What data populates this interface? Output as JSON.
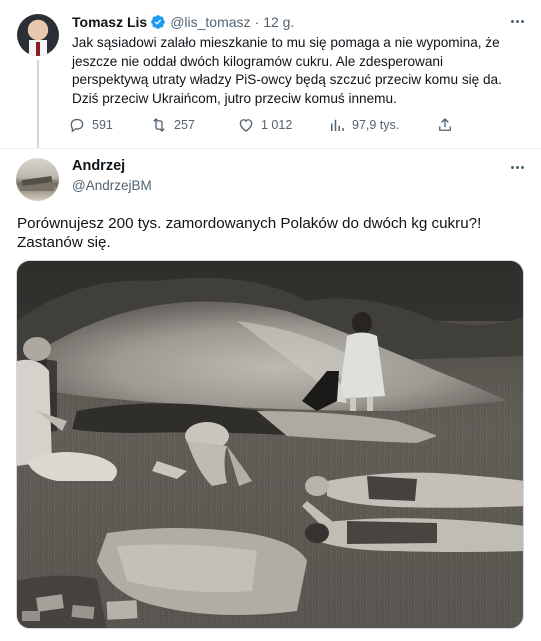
{
  "tweet1": {
    "name": "Tomasz Lis",
    "handle": "@lis_tomasz",
    "separator": "·",
    "time": "12 g.",
    "lines": [
      "Jak sąsiadowi zalało mieszkanie to mu się pomaga a nie wypomina, że",
      "jeszcze nie oddał  dwóch kilogramów cukru. Ale zdesperowani",
      "perspektywą utraty władzy PiS-owcy będą szczuć przeciw komu się da.",
      "Dziś  przeciw Ukraińcom, jutro przeciw komuś innemu."
    ],
    "replies": "591",
    "retweets": "257",
    "likes": "1 012",
    "views": "97,9 tys.",
    "icons": [
      "verified-icon",
      "more-icon",
      "reply-icon",
      "retweet-icon",
      "like-icon",
      "views-icon",
      "share-icon"
    ]
  },
  "tweet2": {
    "name": "Andrzej",
    "handle": "@AndrzejBM",
    "lines": [
      "Porównujesz 200 tys. zamordowanych Polaków do dwóch kg cukru?!",
      "Zastanów się."
    ],
    "icons": [
      "more-icon"
    ]
  },
  "colors": {
    "text": "#0f1419",
    "muted": "#536471",
    "verified": "#1d9bf0",
    "divider": "#eff3f4"
  }
}
